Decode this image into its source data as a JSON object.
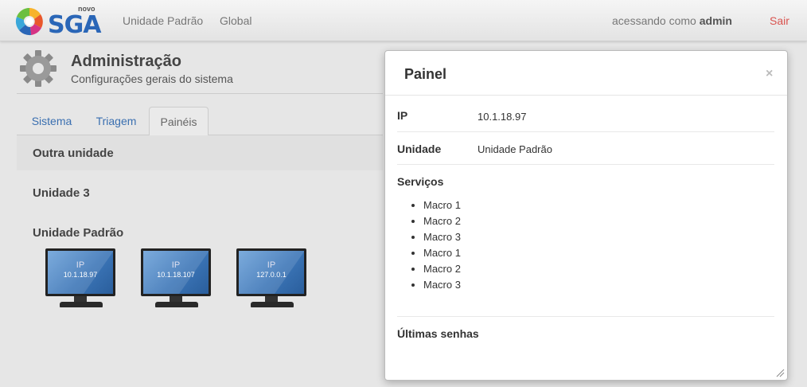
{
  "navbar": {
    "logo_small": "novo",
    "logo_text": "SGA",
    "links": [
      "Unidade Padrão",
      "Global"
    ],
    "user_prefix": "acessando como",
    "user_name": "admin",
    "logout": "Sair"
  },
  "header": {
    "title": "Administração",
    "subtitle": "Configurações gerais do sistema",
    "icon": "gear-icon"
  },
  "tabs": [
    "Sistema",
    "Triagem",
    "Painéis"
  ],
  "active_tab": "Painéis",
  "units": [
    {
      "name": "Outra unidade"
    },
    {
      "name": "Unidade 3"
    },
    {
      "name": "Unidade Padrão"
    }
  ],
  "monitors": [
    {
      "label": "IP",
      "ip": "10.1.18.97"
    },
    {
      "label": "IP",
      "ip": "10.1.18.107"
    },
    {
      "label": "IP",
      "ip": "127.0.0.1"
    }
  ],
  "modal": {
    "title": "Painel",
    "close": "×",
    "ip_label": "IP",
    "ip_value": "10.1.18.97",
    "unit_label": "Unidade",
    "unit_value": "Unidade Padrão",
    "services_label": "Serviços",
    "services": [
      "Macro 1",
      "Macro 2",
      "Macro 3",
      "Macro 1",
      "Macro 2",
      "Macro 3"
    ],
    "last_label": "Últimas senhas"
  },
  "colors": {
    "link": "#3a6fb0",
    "logout": "#d9534f",
    "logo_blue": "#2a66b7",
    "monitor_screen": "#3c76b8"
  }
}
